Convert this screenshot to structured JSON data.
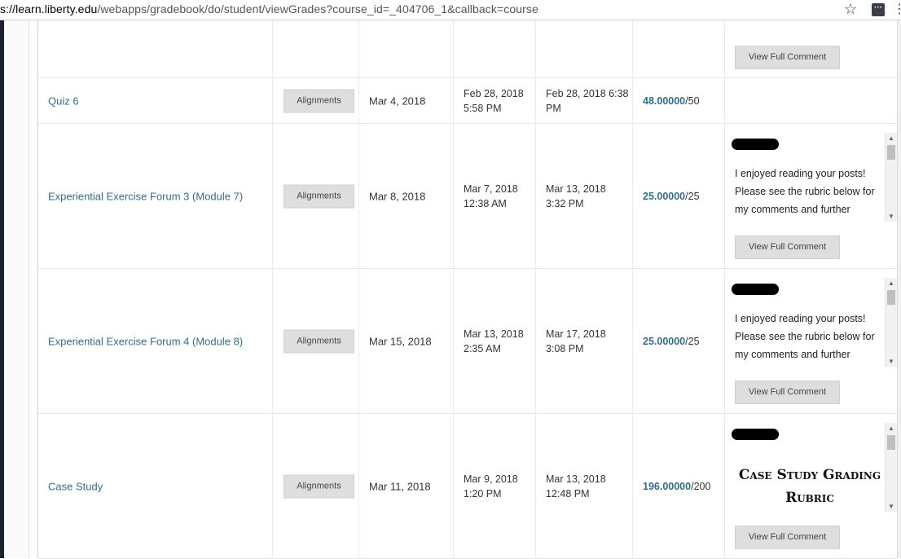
{
  "browser": {
    "url_host": "s://learn.liberty.edu",
    "url_path": "/webapps/gradebook/do/student/viewGrades?course_id=_404706_1&callback=course",
    "star_glyph": "☆",
    "menu_glyph": "⋮",
    "ext_glyph": "▪▪▪"
  },
  "labels": {
    "alignments": "Alignments",
    "view_full_comment": "View Full Comment"
  },
  "rows": [
    {
      "item": "",
      "due": "",
      "created": "",
      "modified": "",
      "grade": "",
      "out_of": "",
      "comment_type": "",
      "comment_text": ""
    },
    {
      "item": "Quiz 6",
      "due": "Mar 4, 2018",
      "created_date": "Feb 28, 2018",
      "created_time": "5:58 PM",
      "modified_date": "Feb 28, 2018 6:38",
      "modified_time": "PM",
      "grade": "48.00000",
      "out_of": "/50"
    },
    {
      "item": "Experiential Exercise Forum 3 (Module 7)",
      "due": "Mar 8, 2018",
      "created_date": "Mar 7, 2018",
      "created_time": "12:38 AM",
      "modified_date": "Mar 13, 2018",
      "modified_time": "3:32 PM",
      "grade": "25.00000",
      "out_of": "/25",
      "comment": "I enjoyed reading your posts!  Please see the rubric below for my comments and further"
    },
    {
      "item": "Experiential Exercise Forum 4 (Module 8)",
      "due": "Mar 15, 2018",
      "created_date": "Mar 13, 2018",
      "created_time": "2:35 AM",
      "modified_date": "Mar 17, 2018",
      "modified_time": "3:08 PM",
      "grade": "25.00000",
      "out_of": "/25",
      "comment": "I enjoyed reading your posts!  Please see the rubric below for my comments and further"
    },
    {
      "item": "Case Study",
      "due": "Mar 11, 2018",
      "created_date": "Mar 9, 2018",
      "created_time": "1:20 PM",
      "modified_date": "Mar 13, 2018",
      "modified_time": "12:48 PM",
      "grade": "196.00000",
      "out_of": "/200",
      "comment_heading_1": "Case Study Grading",
      "comment_heading_2": "Rubric"
    }
  ],
  "colors": {
    "link": "#2f6f8f",
    "button_bg": "#dedede"
  }
}
